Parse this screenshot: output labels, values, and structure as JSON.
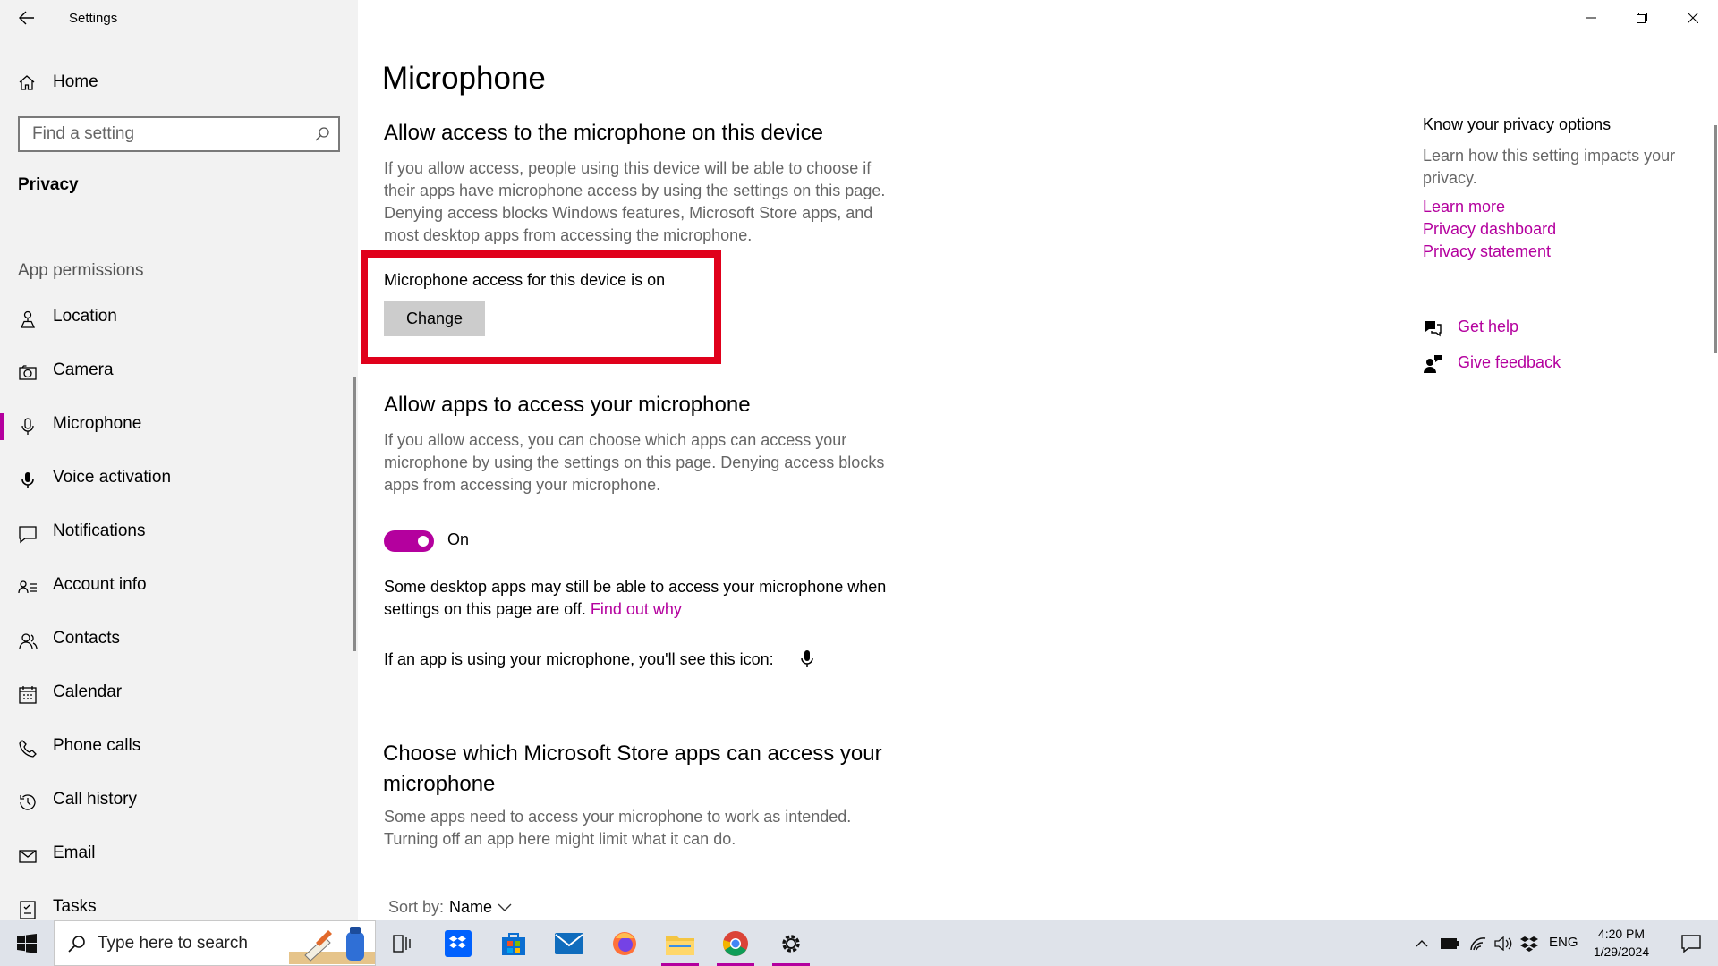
{
  "window": {
    "app_title": "Settings",
    "controls": [
      "minimize-icon",
      "restore-icon",
      "close-icon"
    ]
  },
  "sidebar": {
    "home_label": "Home",
    "search_placeholder": "Find a setting",
    "section_title": "Privacy",
    "permissions_title": "App permissions",
    "items": [
      {
        "label": "Location",
        "icon": "location-icon"
      },
      {
        "label": "Camera",
        "icon": "camera-icon"
      },
      {
        "label": "Microphone",
        "icon": "microphone-icon",
        "active": true
      },
      {
        "label": "Voice activation",
        "icon": "voice-activation-icon"
      },
      {
        "label": "Notifications",
        "icon": "notifications-icon"
      },
      {
        "label": "Account info",
        "icon": "account-info-icon"
      },
      {
        "label": "Contacts",
        "icon": "contacts-icon"
      },
      {
        "label": "Calendar",
        "icon": "calendar-icon"
      },
      {
        "label": "Phone calls",
        "icon": "phone-icon"
      },
      {
        "label": "Call history",
        "icon": "history-icon"
      },
      {
        "label": "Email",
        "icon": "email-icon"
      },
      {
        "label": "Tasks",
        "icon": "tasks-icon"
      }
    ]
  },
  "main": {
    "page_title": "Microphone",
    "device_section": {
      "heading": "Allow access to the microphone on this device",
      "description": "If you allow access, people using this device will be able to choose if their apps have microphone access by using the settings on this page. Denying access blocks Windows features, Microsoft Store apps, and most desktop apps from accessing the microphone.",
      "status_text": "Microphone access for this device is on",
      "change_button": "Change"
    },
    "apps_section": {
      "heading": "Allow apps to access your microphone",
      "description": "If you allow access, you can choose which apps can access your microphone by using the settings on this page. Denying access blocks apps from accessing your microphone.",
      "toggle_state": "On",
      "desktop_note": "Some desktop apps may still be able to access your microphone when settings on this page are off.",
      "find_out_why": "Find out why",
      "icon_note": "If an app is using your microphone, you'll see this icon:"
    },
    "store_section": {
      "heading": "Choose which Microsoft Store apps can access your microphone",
      "description": "Some apps need to access your microphone to work as intended. Turning off an app here might limit what it can do.",
      "sort_label": "Sort by:",
      "sort_value": "Name"
    }
  },
  "right_panel": {
    "heading": "Know your privacy options",
    "description": "Learn how this setting impacts your privacy.",
    "links": [
      "Learn more",
      "Privacy dashboard",
      "Privacy statement"
    ],
    "help": {
      "label": "Get help",
      "icon": "help-chat-icon"
    },
    "feedback": {
      "label": "Give feedback",
      "icon": "feedback-icon"
    }
  },
  "taskbar": {
    "search_placeholder": "Type here to search",
    "apps": [
      {
        "name": "task-view-icon"
      },
      {
        "name": "dropbox-icon"
      },
      {
        "name": "microsoft-store-icon"
      },
      {
        "name": "mail-icon"
      },
      {
        "name": "firefox-icon"
      },
      {
        "name": "file-explorer-icon",
        "running": true
      },
      {
        "name": "chrome-icon",
        "running": true
      },
      {
        "name": "settings-icon",
        "running": true
      }
    ],
    "language": "ENG",
    "time": "4:20 PM",
    "date": "1/29/2024"
  },
  "colors": {
    "accent": "#b4009e",
    "highlight_box": "#e0001b",
    "sidebar_bg": "#f2f2f2",
    "taskbar_bg": "#dfe3ea"
  }
}
